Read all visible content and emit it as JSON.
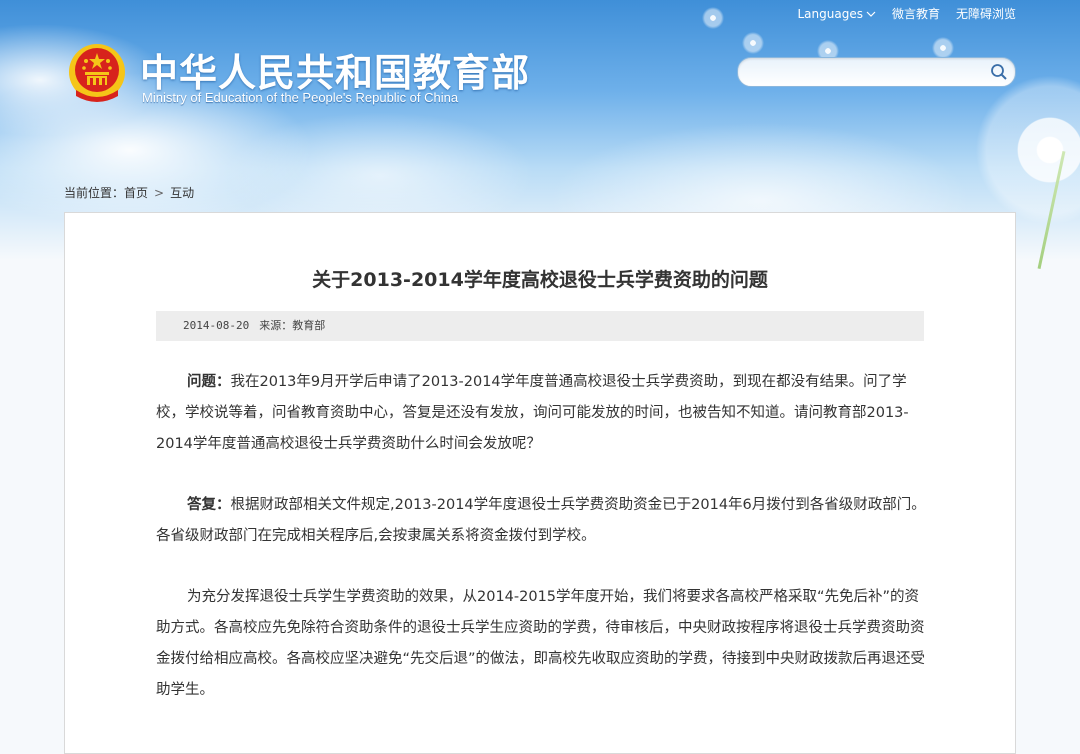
{
  "header": {
    "nav": {
      "languages": "Languages",
      "weibo": "微言教育",
      "accessibility": "无障碍浏览"
    },
    "logo_cn": "中华人民共和国教育部",
    "logo_en": "Ministry of Education of the People's Republic of China",
    "search": {
      "value": "",
      "placeholder": ""
    }
  },
  "breadcrumb": {
    "label": "当前位置：",
    "home": "首页",
    "separator": ">",
    "current": "互动"
  },
  "article": {
    "title": "关于2013-2014学年度高校退役士兵学费资助的问题",
    "date": "2014-08-20",
    "source": "来源：教育部",
    "question_label": "问题：",
    "question_text": "我在2013年9月开学后申请了2013-2014学年度普通高校退役士兵学费资助，到现在都没有结果。问了学校，学校说等着，问省教育资助中心，答复是还没有发放，询问可能发放的时间，也被告知不知道。请问教育部2013-2014学年度普通高校退役士兵学费资助什么时间会发放呢？",
    "answer_label": "答复：",
    "answer_text": "根据财政部相关文件规定,2013-2014学年度退役士兵学费资助资金已于2014年6月拨付到各省级财政部门。各省级财政部门在完成相关程序后,会按隶属关系将资金拨付到学校。",
    "paragraph3": "为充分发挥退役士兵学生学费资助的效果，从2014-2015学年度开始，我们将要求各高校严格采取“先免后补”的资助方式。各高校应先免除符合资助条件的退役士兵学生应资助的学费，待审核后，中央财政按程序将退役士兵学费资助资金拨付给相应高校。各高校应坚决避免“先交后退”的做法，即高校先收取应资助的学费，待接到中央财政拨款后再退还受助学生。"
  },
  "colors": {
    "sky_top": "#3f8fd8",
    "text": "#333333",
    "meta_bg": "#ededed",
    "emblem_red": "#d7231c",
    "emblem_gold": "#f5c518"
  }
}
